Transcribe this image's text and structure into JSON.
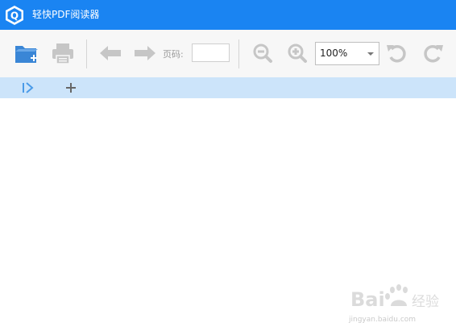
{
  "app": {
    "title": "轻快PDF阅读器",
    "logo_letter": "Q"
  },
  "toolbar": {
    "open_icon": "folder-open-icon",
    "print_icon": "printer-icon",
    "prev_icon": "arrow-left-icon",
    "next_icon": "arrow-right-icon",
    "page_label": "页码:",
    "page_value": "",
    "zoom_out_icon": "zoom-out-icon",
    "zoom_in_icon": "zoom-in-icon",
    "zoom_value": "100%",
    "rotate_left_icon": "rotate-left-icon",
    "rotate_right_icon": "rotate-right-icon"
  },
  "tabs": {
    "sidebar_toggle_icon": "sidebar-toggle-icon",
    "new_tab_icon": "plus-icon"
  },
  "watermark": {
    "brand": "Bai",
    "brand_cn": "经验",
    "url": "jingyan.baidu.com"
  },
  "colors": {
    "titlebar": "#1a84f2",
    "toolbar": "#f7f7f7",
    "tabstrip": "#cce4fa",
    "folder": "#3a86d6",
    "disabled_icon": "#c6c6c6"
  }
}
